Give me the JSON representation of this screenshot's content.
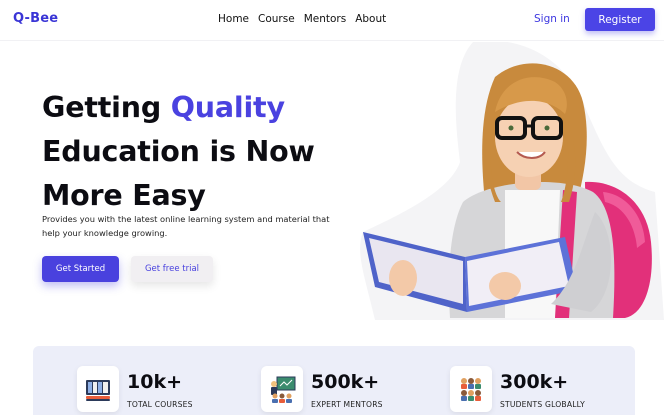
{
  "nav": {
    "logo": "Q-Bee",
    "links": [
      "Home",
      "Course",
      "Mentors",
      "About"
    ],
    "signin": "Sign in",
    "register": "Register"
  },
  "hero": {
    "headline_line1_plain": "Getting ",
    "headline_line1_accent": "Quality",
    "headline_line2": "Education is Now",
    "headline_line3": "More Easy",
    "subtext": "Provides you with the latest online learning system and material that help your knowledge growing.",
    "cta_primary": "Get Started",
    "cta_secondary": "Get free trial"
  },
  "stats": [
    {
      "value": "10k+",
      "label": "TOTAL COURSES",
      "icon": "books-icon"
    },
    {
      "value": "500k+",
      "label": "EXPERT MENTORS",
      "icon": "mentor-board-icon"
    },
    {
      "value": "300k+",
      "label": "STUDENTS GLOBALLY",
      "icon": "students-group-icon"
    }
  ],
  "colors": {
    "accent": "#4a42e0",
    "stats_bg": "#eceef9"
  }
}
